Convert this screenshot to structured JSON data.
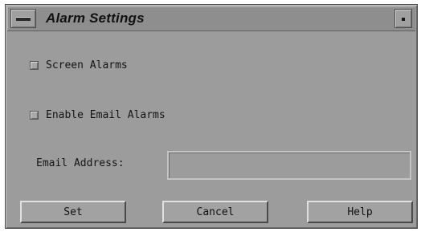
{
  "window": {
    "title": "Alarm Settings"
  },
  "options": {
    "screen_alarms_label": "Screen Alarms",
    "enable_email_alarms_label": "Enable Email Alarms",
    "screen_alarms_checked": false,
    "enable_email_alarms_checked": false
  },
  "email": {
    "label": "Email Address:",
    "value": ""
  },
  "buttons": {
    "set": "Set",
    "cancel": "Cancel",
    "help": "Help"
  },
  "icons": {
    "menu": "window-menu-icon",
    "minimize": "minimize-icon"
  },
  "colors": {
    "window_bg": "#9c9c9c",
    "titlebar_bg": "#8e8e8e"
  }
}
